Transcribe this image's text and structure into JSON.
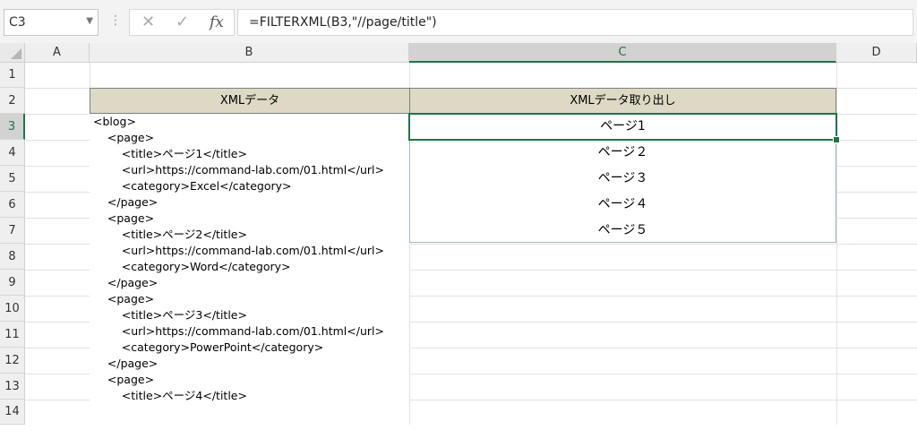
{
  "formula_bar": {
    "name_box": "C3",
    "formula": "=FILTERXML(B3,\"//page/title\")",
    "separator": "⋮",
    "cancel_glyph": "✕",
    "enter_glyph": "✓",
    "fx_label": "fx"
  },
  "columns": [
    "A",
    "B",
    "C",
    "D"
  ],
  "rows": [
    "1",
    "2",
    "3",
    "4",
    "5",
    "6",
    "7",
    "8",
    "9",
    "10",
    "11",
    "12",
    "13",
    "14"
  ],
  "headers": {
    "b2": "XMLデータ",
    "c2": "XMLデータ取り出し"
  },
  "xml_lines": [
    "<blog>",
    "    <page>",
    "        <title>ページ1</title>",
    "        <url>https://command-lab.com/01.html</url>",
    "        <category>Excel</category>",
    "    </page>",
    "    <page>",
    "        <title>ページ2</title>",
    "        <url>https://command-lab.com/01.html</url>",
    "        <category>Word</category>",
    "    </page>",
    "    <page>",
    "        <title>ページ3</title>",
    "        <url>https://command-lab.com/01.html</url>",
    "        <category>PowerPoint</category>",
    "    </page>",
    "    <page>",
    "        <title>ページ4</title>"
  ],
  "results": [
    "ページ1",
    "ページ２",
    "ページ３",
    "ページ４",
    "ページ５"
  ]
}
